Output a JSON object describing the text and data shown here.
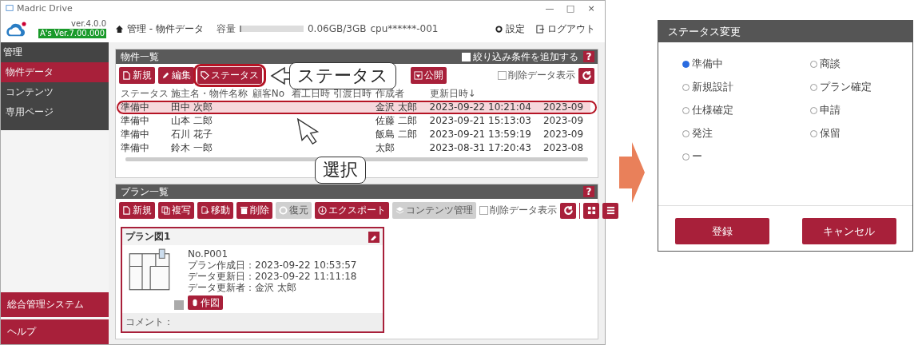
{
  "window": {
    "title": "Madric Drive",
    "controls": [
      "—",
      "□",
      "×"
    ]
  },
  "header": {
    "version": "ver.4.0.0",
    "badge": "A's Ver.7.00.000",
    "breadcrumb": "管理 - 物件データ",
    "storage_label": "容量",
    "storage": {
      "level": 0.02
    },
    "storage_text": "0.06GB/3GB",
    "cpu": "cpu******-001",
    "settings": "設定",
    "logout": "ログアウト"
  },
  "sidebar": {
    "section": "管理",
    "items": [
      {
        "label": "物件データ",
        "selected": true
      },
      {
        "label": "コンテンツ",
        "selected": false
      },
      {
        "label": "専用ページ",
        "selected": false
      }
    ],
    "bottom": [
      "総合管理システム",
      "ヘルプ"
    ]
  },
  "property_panel": {
    "title": "物件一覧",
    "filter": "絞り込み条件を追加する",
    "help": "?",
    "buttons": [
      {
        "label": "新規",
        "disabled": false
      },
      {
        "label": "編集",
        "disabled": false
      },
      {
        "label": "ステータス",
        "disabled": false
      },
      {
        "label": "公開",
        "disabled": false
      }
    ],
    "show_deleted": {
      "label": "削除データ表示",
      "checked": false
    },
    "columns": [
      "ステータス",
      "施主名・物件名称",
      "顧客No",
      "着工日時",
      "引渡日時",
      "作成者",
      "更新日時↓"
    ],
    "rows": [
      {
        "cells": [
          "準備中",
          "田中 次郎",
          "",
          "",
          "",
          "金沢 太郎",
          "2023-09-22 10:21:04",
          "2023-09"
        ],
        "selected": true
      },
      {
        "cells": [
          "準備中",
          "山本 二郎",
          "",
          "",
          "",
          "佐藤 二郎",
          "2023-09-21 15:13:03",
          "2023-09"
        ],
        "selected": false
      },
      {
        "cells": [
          "準備中",
          "石川 花子",
          "",
          "",
          "",
          "飯島 二郎",
          "2023-09-21 13:59:19",
          "2023-09"
        ],
        "selected": false
      },
      {
        "cells": [
          "準備中",
          "鈴木 一郎",
          "",
          "",
          "",
          "太郎",
          "2023-08-31 17:20:43",
          "2023-08"
        ],
        "selected": false
      }
    ]
  },
  "plan_panel": {
    "title": "プラン一覧",
    "help": "?",
    "buttons": [
      {
        "label": "新規",
        "disabled": false
      },
      {
        "label": "複写",
        "disabled": false
      },
      {
        "label": "移動",
        "disabled": false
      },
      {
        "label": "削除",
        "disabled": false
      },
      {
        "label": "復元",
        "disabled": true
      },
      {
        "label": "エクスポート",
        "disabled": false
      },
      {
        "label": "コンテンツ管理",
        "disabled": true
      }
    ],
    "show_deleted": {
      "label": "削除データ表示",
      "checked": false
    },
    "card": {
      "title": "プラン図1",
      "lines": [
        "No.P001",
        "プラン作成日：2023-09-22 10:53:57",
        "データ更新日：2023-09-22 11:11:18",
        "データ更新者：金沢 太郎"
      ],
      "draw_button": "作図",
      "comment": "コメント："
    }
  },
  "annotations": [
    "ステータス",
    "選択"
  ],
  "dialog": {
    "title": "ステータス変更",
    "options": [
      {
        "label": "準備中",
        "selected": true
      },
      {
        "label": "商談",
        "selected": false
      },
      {
        "label": "新規設計",
        "selected": false
      },
      {
        "label": "プラン確定",
        "selected": false
      },
      {
        "label": "仕様確定",
        "selected": false
      },
      {
        "label": "申請",
        "selected": false
      },
      {
        "label": "発注",
        "selected": false
      },
      {
        "label": "保留",
        "selected": false
      },
      {
        "label": "ー",
        "selected": false
      }
    ],
    "buttons": [
      "登録",
      "キャンセル"
    ]
  }
}
